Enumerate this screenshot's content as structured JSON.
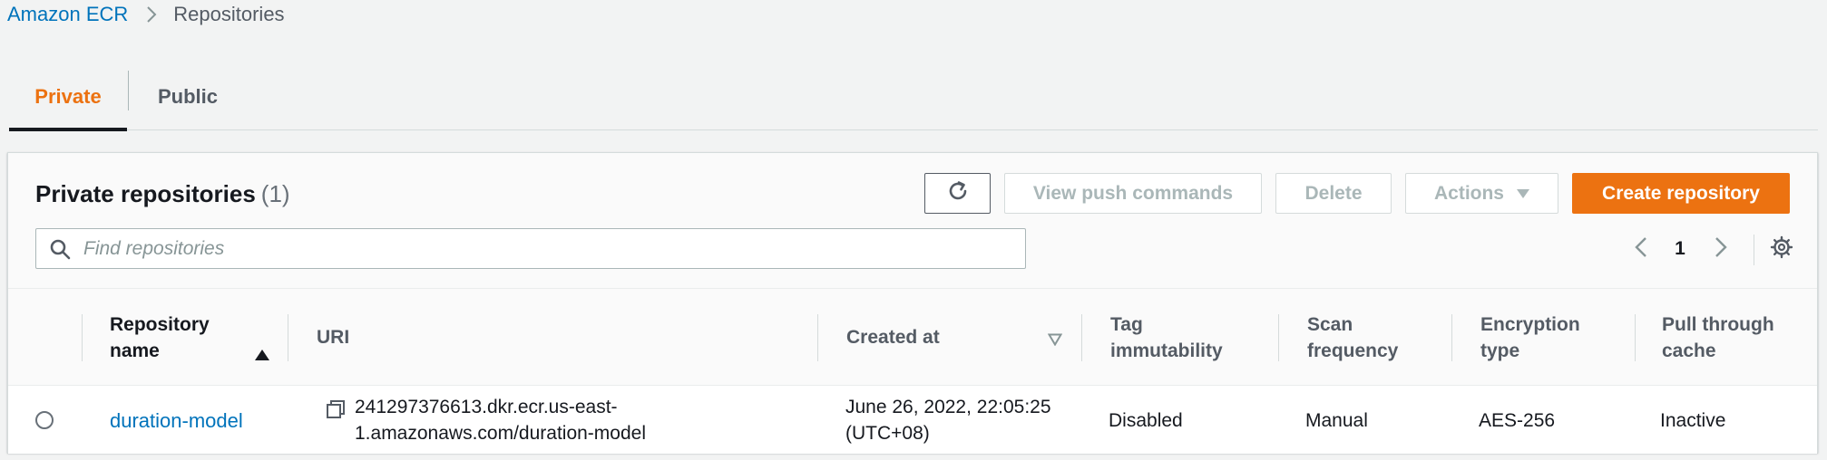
{
  "breadcrumb": {
    "root": "Amazon ECR",
    "current": "Repositories"
  },
  "tabs": [
    {
      "label": "Private",
      "active": true
    },
    {
      "label": "Public",
      "active": false
    }
  ],
  "panel": {
    "title": "Private repositories",
    "count": "(1)",
    "buttons": {
      "view_push_commands": "View push commands",
      "delete": "Delete",
      "actions": "Actions",
      "create_repository": "Create repository"
    },
    "search": {
      "placeholder": "Find repositories",
      "value": ""
    },
    "pagination": {
      "current_page": "1"
    }
  },
  "table": {
    "columns": [
      {
        "line1": "Repository",
        "line2": "name",
        "sort": "ascending"
      },
      {
        "line1": "URI",
        "line2": ""
      },
      {
        "line1": "Created at",
        "line2": "",
        "sort": "sortable"
      },
      {
        "line1": "Tag",
        "line2": "immutability"
      },
      {
        "line1": "Scan",
        "line2": "frequency"
      },
      {
        "line1": "Encryption",
        "line2": "type"
      },
      {
        "line1": "Pull through",
        "line2": "cache"
      }
    ],
    "rows": [
      {
        "selected": false,
        "name": "duration-model",
        "uri_line1": "241297376613.dkr.ecr.us-east-",
        "uri_line2": "1.amazonaws.com/duration-model",
        "created_line1": "June 26, 2022, 22:05:25",
        "created_line2": "(UTC+08)",
        "tag_immutability": "Disabled",
        "scan_frequency": "Manual",
        "encryption_type": "AES-256",
        "pull_through_cache": "Inactive"
      }
    ]
  },
  "colors": {
    "accent_orange": "#ec7211",
    "link_blue": "#0073bb",
    "text_dark": "#16191f",
    "text_muted": "#545b64",
    "disabled": "#aab7b8"
  }
}
